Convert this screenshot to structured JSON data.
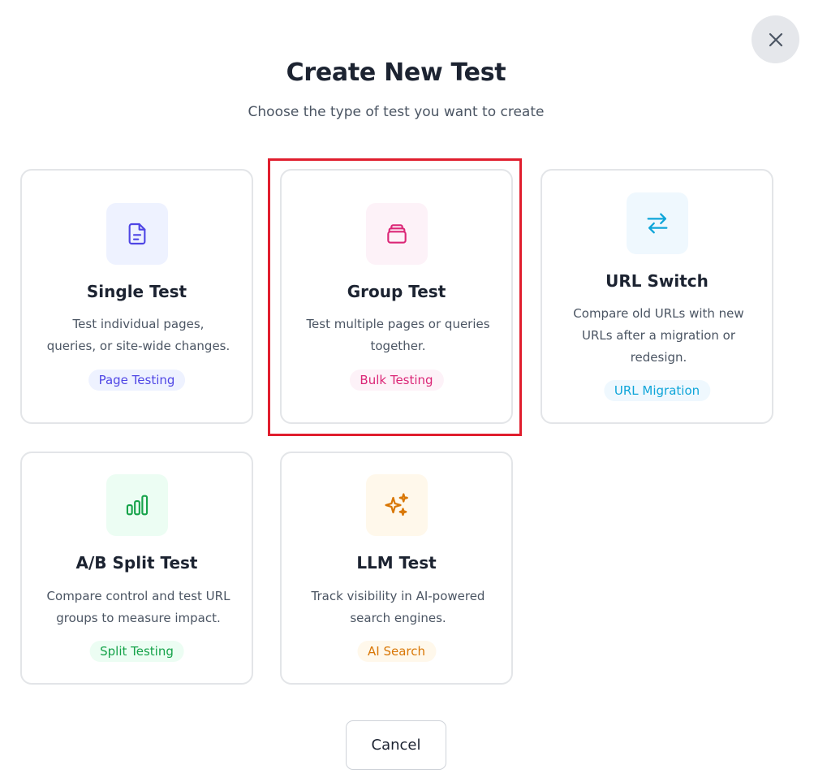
{
  "dialog": {
    "title": "Create New Test",
    "subtitle": "Choose the type of test you want to create",
    "close_icon": "close-icon",
    "cancel_label": "Cancel",
    "selected_card": "group-test"
  },
  "cards": [
    {
      "id": "single-test",
      "title": "Single Test",
      "description": "Test individual pages, queries, or site-wide changes.",
      "badge": "Page Testing",
      "icon": "document-icon",
      "accent": "#4f46e5",
      "icon_bg": "#eef2ff",
      "badge_bg": "#eef2ff"
    },
    {
      "id": "group-test",
      "title": "Group Test",
      "description": "Test multiple pages or queries together.",
      "badge": "Bulk Testing",
      "icon": "stack-icon",
      "accent": "#db2777",
      "icon_bg": "#fdf2f8",
      "badge_bg": "#fdf2f8"
    },
    {
      "id": "url-switch",
      "title": "URL Switch",
      "description": "Compare old URLs with new URLs after a migration or redesign.",
      "badge": "URL Migration",
      "icon": "swap-arrows-icon",
      "accent": "#0ea5d9",
      "icon_bg": "#eff8fe",
      "badge_bg": "#eff8fe"
    },
    {
      "id": "ab-split-test",
      "title": "A/B Split Test",
      "description": "Compare control and test URL groups to measure impact.",
      "badge": "Split Testing",
      "icon": "bar-chart-icon",
      "accent": "#16a34a",
      "icon_bg": "#ecfdf3",
      "badge_bg": "#ecfdf3"
    },
    {
      "id": "llm-test",
      "title": "LLM Test",
      "description": "Track visibility in AI-powered search engines.",
      "badge": "AI Search",
      "icon": "sparkles-icon",
      "accent": "#d97706",
      "icon_bg": "#fff8eb",
      "badge_bg": "#fff8eb"
    }
  ]
}
